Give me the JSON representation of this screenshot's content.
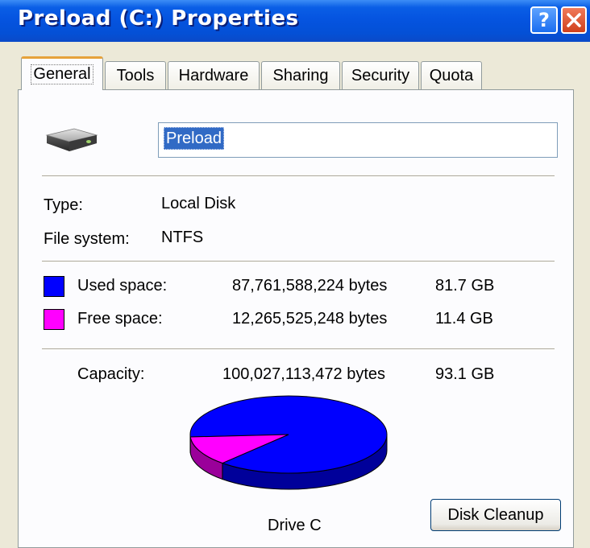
{
  "window": {
    "title": "Preload (C:) Properties",
    "help_glyph": "?",
    "title_bar_color": "#0554e0"
  },
  "tabs": [
    {
      "label": "General",
      "active": true
    },
    {
      "label": "Tools",
      "active": false
    },
    {
      "label": "Hardware",
      "active": false
    },
    {
      "label": "Sharing",
      "active": false
    },
    {
      "label": "Security",
      "active": false
    },
    {
      "label": "Quota",
      "active": false
    }
  ],
  "general": {
    "drive_icon": "hard-drive-icon",
    "volume_name": "Preload",
    "type_label": "Type:",
    "type_value": "Local Disk",
    "fs_label": "File system:",
    "fs_value": "NTFS",
    "used": {
      "label": "Used space:",
      "bytes": "87,761,588,224 bytes",
      "size": "81.7 GB",
      "color": "#0000ff"
    },
    "free": {
      "label": "Free space:",
      "bytes": "12,265,525,248 bytes",
      "size": "11.4 GB",
      "color": "#ff00ff"
    },
    "capacity": {
      "label": "Capacity:",
      "bytes": "100,027,113,472 bytes",
      "size": "93.1 GB"
    },
    "drive_label": "Drive C",
    "cleanup_button": "Disk Cleanup"
  },
  "chart_data": {
    "type": "pie",
    "slices": [
      {
        "label": "Used space",
        "value": 87761588224,
        "color": "#0000ff"
      },
      {
        "label": "Free space",
        "value": 12265525248,
        "color": "#ff00ff"
      }
    ],
    "title": "Drive C"
  }
}
